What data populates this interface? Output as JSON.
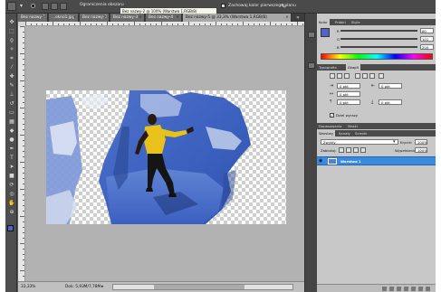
{
  "options": {
    "check1": "Ograniczenia obszaru",
    "check2": "Zachowaj kolor pierwszego planu"
  },
  "tooltip": "Bez nazwy-2 @ 100% (Warstwa 1,RGB/8)",
  "tabs": [
    {
      "label": "Bez nazwy-1",
      "active": false
    },
    {
      "label": "...okno1.jpg",
      "active": false
    },
    {
      "label": "Bez nazwy-2",
      "active": false
    },
    {
      "label": "Bez nazwy-3",
      "active": false
    },
    {
      "label": "Bez nazwy-4",
      "active": false
    },
    {
      "label": "Bez nazwy-5 @ 33,3% (Warstwa 1,RGB/8)",
      "active": true
    }
  ],
  "status": {
    "zoom": "33,33%",
    "doc": "Dok: 5,93M/7,78M"
  },
  "color_panel": {
    "tabs": [
      "Kolor",
      "Próbki",
      "Style"
    ],
    "R": {
      "label": "R",
      "value": "80"
    },
    "G": {
      "label": "G",
      "value": "101"
    },
    "B": {
      "label": "B",
      "value": "200"
    },
    "foreground": "#5065c8",
    "background": "#ffffff"
  },
  "char_panel": {
    "tabs": [
      "Typografia",
      "Akapit"
    ],
    "fields": [
      "0 pkt",
      "0 pkt",
      "0 pkt",
      "0 pkt",
      "0 pkt"
    ],
    "hyphen_label": "Dziel wyrazy"
  },
  "layers_panel": {
    "top_tabs": [
      "Dopasowania",
      "Maski"
    ],
    "tabs": [
      "Warstwy",
      "Kanały",
      "Ścieżki"
    ],
    "blend_mode": "Zwykły",
    "opacity_label": "Krycie:",
    "opacity": "100%",
    "lock_label": "Zablokuj:",
    "fill_label": "Wypełnienie:",
    "fill": "100%",
    "layer_name": "Warstwa 1"
  },
  "icons": [
    "move-icon",
    "marquee-icon",
    "lasso-icon",
    "quick-select-icon",
    "crop-icon",
    "eyedropper-icon",
    "healing-icon",
    "brush-icon",
    "clone-stamp-icon",
    "history-brush-icon",
    "eraser-icon",
    "gradient-icon",
    "blur-icon",
    "dodge-icon",
    "pen-icon",
    "type-icon",
    "path-select-icon",
    "shape-icon",
    "3d-rotate-icon",
    "3d-camera-icon",
    "hand-icon",
    "zoom-icon"
  ]
}
